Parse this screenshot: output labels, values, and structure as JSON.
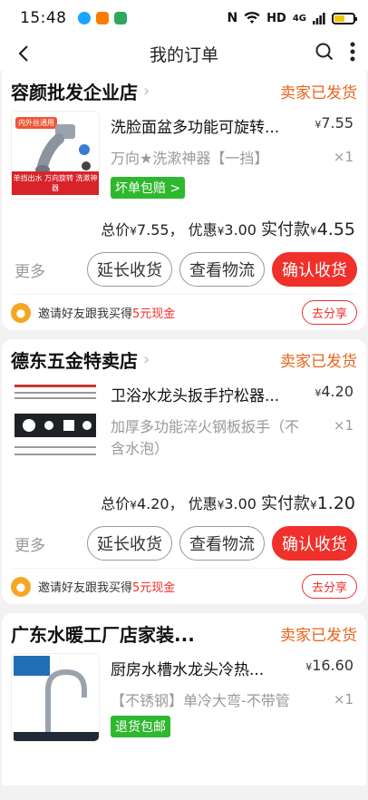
{
  "status_bar": {
    "time": "15:48",
    "network": "HD",
    "signal": "4G"
  },
  "nav": {
    "title": "我的订单"
  },
  "orders": [
    {
      "shop": "容颜批发企业店",
      "status": "卖家已发货",
      "item_title": "洗脸面盆多功能可旋转...",
      "item_spec": "万向★洗漱神器【一挡】",
      "price": "7.55",
      "qty": "×1",
      "tag": "坏单包赔 >",
      "total_price": "7.55",
      "discount": "3.00",
      "paid": "4.55",
      "img_top": "内外丝通用",
      "img_bottom": "单挡出水 万向旋转 洗漱神器"
    },
    {
      "shop": "德东五金特卖店",
      "status": "卖家已发货",
      "item_title": "卫浴水龙头扳手拧松器...",
      "item_spec": "加厚多功能淬火钢板扳手（不含水泡）",
      "price": "4.20",
      "qty": "×1",
      "tag": "",
      "total_price": "4.20",
      "discount": "3.00",
      "paid": "1.20"
    },
    {
      "shop": "广东水暖工厂店家装...",
      "status": "卖家已发货",
      "item_title": "厨房水槽水龙头冷热...",
      "item_spec": "【不锈钢】单冷大弯-不带管",
      "price": "16.60",
      "qty": "×1",
      "tag": "退货包邮"
    }
  ],
  "labels": {
    "total": "总价",
    "discount": "优惠",
    "paid": "实付款",
    "yen": "¥",
    "more": "更多",
    "extend": "延长收货",
    "logistics": "查看物流",
    "confirm": "确认收货",
    "share_prefix": "邀请好友跟我买得",
    "share_highlight": "5元现金",
    "share_btn": "去分享",
    "comma": "，"
  }
}
